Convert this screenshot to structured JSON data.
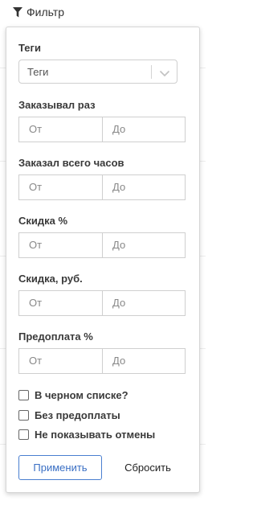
{
  "toolbar": {
    "filter_label": "Фильтр"
  },
  "filter": {
    "tags": {
      "label": "Теги",
      "placeholder": "Теги"
    },
    "ranges": [
      {
        "label": "Заказывал раз",
        "from_placeholder": "От",
        "to_placeholder": "До"
      },
      {
        "label": "Заказал всего часов",
        "from_placeholder": "От",
        "to_placeholder": "До"
      },
      {
        "label": "Скидка %",
        "from_placeholder": "От",
        "to_placeholder": "До"
      },
      {
        "label": "Скидка, руб.",
        "from_placeholder": "От",
        "to_placeholder": "До"
      },
      {
        "label": "Предоплата %",
        "from_placeholder": "От",
        "to_placeholder": "До"
      }
    ],
    "checkboxes": [
      {
        "label": "В черном списке?",
        "checked": false
      },
      {
        "label": "Без предоплаты",
        "checked": false
      },
      {
        "label": "Не показывать отмены",
        "checked": false
      }
    ],
    "apply_label": "Применить",
    "reset_label": "Сбросить"
  },
  "colors": {
    "accent": "#3a6fc4",
    "border": "#cfcfcf"
  }
}
